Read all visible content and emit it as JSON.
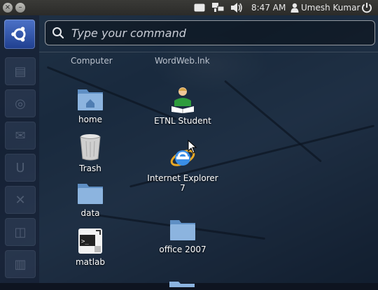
{
  "top_panel": {
    "clock": "8:47 AM",
    "user_name": "Umesh Kumar",
    "close_glyph": "×",
    "minimize_glyph": "–"
  },
  "search": {
    "placeholder": "Type your command"
  },
  "dash": {
    "sections": [
      "Computer",
      "WordWeb.lnk"
    ],
    "items": [
      {
        "label": "home",
        "icon": "home-folder-icon"
      },
      {
        "label": "Trash",
        "icon": "trash-icon"
      },
      {
        "label": "data",
        "icon": "folder-icon"
      },
      {
        "label": "matlab",
        "icon": "matlab-icon"
      },
      {
        "label": "ETNL Student",
        "icon": "student-icon"
      },
      {
        "label": "Internet Explorer 7",
        "icon": "internet-explorer-icon"
      },
      {
        "label": "office 2007",
        "icon": "folder-icon"
      }
    ]
  },
  "colors": {
    "launcher_button": "#2f55b0",
    "folder_blue": "#7fa9d4",
    "panel_bg": "#3a3a37"
  }
}
